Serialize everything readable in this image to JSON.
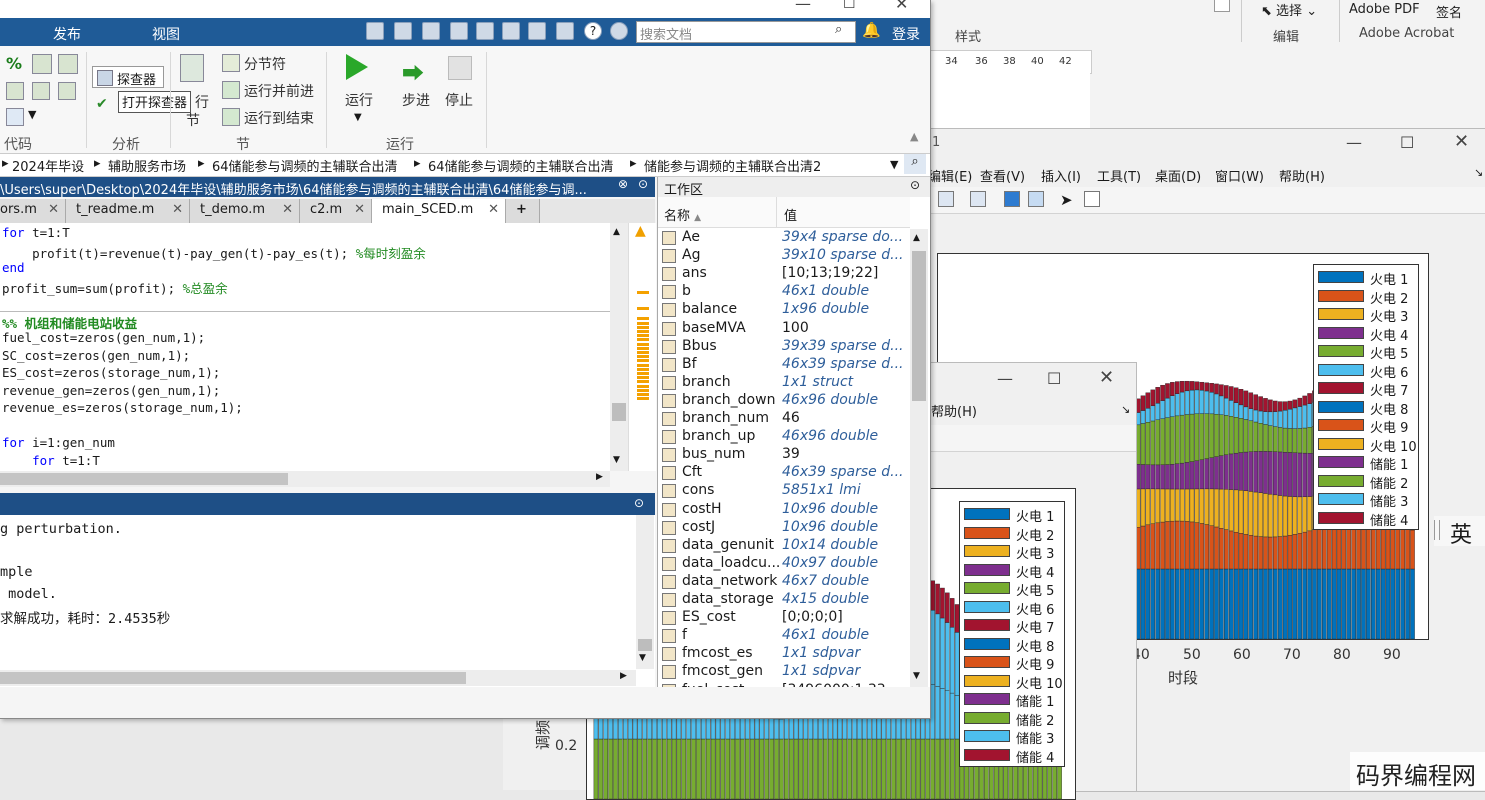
{
  "matlab": {
    "tabs": [
      "发布",
      "视图"
    ],
    "search_placeholder": "搜索文档",
    "login_label": "登录",
    "ribbon": {
      "browser_button": "探查器",
      "tooltip": "打开探查器",
      "run_section_partial": "行",
      "section_partial": "节",
      "section_break": "分节符",
      "run_and_advance": "运行并前进",
      "run_to_end": "运行到结束",
      "run": "运行",
      "step": "步进",
      "stop": "停止",
      "groups": [
        "代码",
        "分析",
        "节",
        "运行"
      ]
    },
    "address_bar": [
      "2024年毕设",
      "辅助服务市场",
      "64储能参与调频的主辅联合出清",
      "64储能参与调频的主辅联合出清",
      "储能参与调频的主辅联合出清2"
    ],
    "editor": {
      "title": "\\Users\\super\\Desktop\\2024年毕设\\辅助服务市场\\64储能参与调频的主辅联合出清\\64储能参与调...",
      "tabs": [
        "ors.m",
        "t_readme.m",
        "t_demo.m",
        "c2.m",
        "main_SCED.m"
      ],
      "add_tab": "+",
      "lines": [
        {
          "kw": "for",
          "text": " t=1:T"
        },
        {
          "indent": "    ",
          "text": "profit(t)=revenue(t)-pay_gen(t)-pay_es(t); ",
          "comment": "%每时刻盈余"
        },
        {
          "kw": "end",
          "text": ""
        },
        {
          "text": "profit_sum=sum(profit); ",
          "comment": "%总盈余"
        },
        {
          "text": ""
        },
        {
          "section": "%% 机组和储能电站收益"
        },
        {
          "text": "fuel_cost=zeros(gen_num,1);"
        },
        {
          "text": "SC_cost=zeros(gen_num,1);"
        },
        {
          "text": "ES_cost=zeros(storage_num,1);"
        },
        {
          "text": "revenue_gen=zeros(gen_num,1);"
        },
        {
          "text": "revenue_es=zeros(storage_num,1);"
        },
        {
          "text": ""
        },
        {
          "kw": "for",
          "text": " i=1:gen_num"
        },
        {
          "indent": "    ",
          "kw": "for",
          "text": " t=1:T"
        }
      ]
    },
    "command_window": {
      "lines": [
        "g perturbation.",
        "",
        "mple",
        " model.",
        "求解成功，耗时：2.4535秒"
      ]
    },
    "workspace": {
      "title": "工作区",
      "col_name": "名称",
      "col_value": "值",
      "rows": [
        {
          "name": "Ae",
          "value": "39x4 sparse do...",
          "italic": true
        },
        {
          "name": "Ag",
          "value": "39x10 sparse d...",
          "italic": true
        },
        {
          "name": "ans",
          "value": "[10;13;19;22]",
          "italic": false
        },
        {
          "name": "b",
          "value": "46x1 double",
          "italic": true
        },
        {
          "name": "balance",
          "value": "1x96 double",
          "italic": true
        },
        {
          "name": "baseMVA",
          "value": "100",
          "italic": false
        },
        {
          "name": "Bbus",
          "value": "39x39 sparse d...",
          "italic": true
        },
        {
          "name": "Bf",
          "value": "46x39 sparse d...",
          "italic": true
        },
        {
          "name": "branch",
          "value": "1x1 struct",
          "italic": true
        },
        {
          "name": "branch_down",
          "value": "46x96 double",
          "italic": true
        },
        {
          "name": "branch_num",
          "value": "46",
          "italic": false
        },
        {
          "name": "branch_up",
          "value": "46x96 double",
          "italic": true
        },
        {
          "name": "bus_num",
          "value": "39",
          "italic": false
        },
        {
          "name": "Cft",
          "value": "46x39 sparse d...",
          "italic": true
        },
        {
          "name": "cons",
          "value": "5851x1 lmi",
          "italic": true
        },
        {
          "name": "costH",
          "value": "10x96 double",
          "italic": true
        },
        {
          "name": "costJ",
          "value": "10x96 double",
          "italic": true
        },
        {
          "name": "data_genunit",
          "value": "10x14 double",
          "italic": true
        },
        {
          "name": "data_loadcu...",
          "value": "40x97 double",
          "italic": true
        },
        {
          "name": "data_network",
          "value": "46x7 double",
          "italic": true
        },
        {
          "name": "data_storage",
          "value": "4x15 double",
          "italic": true
        },
        {
          "name": "ES_cost",
          "value": "[0;0;0;0]",
          "italic": false
        },
        {
          "name": "f",
          "value": "46x1 double",
          "italic": true
        },
        {
          "name": "fmcost_es",
          "value": "1x1 sdpvar",
          "italic": true
        },
        {
          "name": "fmcost_gen",
          "value": "1x1 sdpvar",
          "italic": true
        },
        {
          "name": "fuel_cost",
          "value": "[3496000;1.33...",
          "italic": false
        }
      ]
    }
  },
  "word": {
    "find_label": "选择",
    "adobe_pdf": "Adobe PDF",
    "sign": "签名",
    "edit_group": "编辑",
    "acrobat_group": "Adobe Acrobat",
    "style_group": "样式",
    "ruler_ticks": [
      "34",
      "36",
      "38",
      "40",
      "42"
    ]
  },
  "figure1": {
    "menu": [
      "编辑(E)",
      "查看(V)",
      "插入(I)",
      "工具(T)",
      "桌面(D)",
      "窗口(W)",
      "帮助(H)"
    ],
    "title_partial": "1"
  },
  "figure2": {
    "menu_help": "帮助(H)"
  },
  "legend_entries": [
    {
      "label": "火电 1",
      "color": "#0072bd"
    },
    {
      "label": "火电 2",
      "color": "#d95319"
    },
    {
      "label": "火电 3",
      "color": "#edb120"
    },
    {
      "label": "火电 4",
      "color": "#7e2f8e"
    },
    {
      "label": "火电 5",
      "color": "#77ac30"
    },
    {
      "label": "火电 6",
      "color": "#4dbeee"
    },
    {
      "label": "火电 7",
      "color": "#a2142f"
    },
    {
      "label": "火电 8",
      "color": "#0072bd"
    },
    {
      "label": "火电 9",
      "color": "#d95319"
    },
    {
      "label": "火电 10",
      "color": "#edb120"
    },
    {
      "label": "储能 1",
      "color": "#7e2f8e"
    },
    {
      "label": "储能 2",
      "color": "#77ac30"
    },
    {
      "label": "储能 3",
      "color": "#4dbeee"
    },
    {
      "label": "储能 4",
      "color": "#a2142f"
    }
  ],
  "chart_data": [
    {
      "type": "bar",
      "stacked": true,
      "xlabel": "时段",
      "x_tick_labels": [
        "40",
        "50",
        "60",
        "70",
        "80",
        "90"
      ],
      "x_range": [
        1,
        96
      ],
      "legend": "top-right"
    },
    {
      "type": "bar",
      "stacked": true,
      "ylabel": "调频",
      "y_tick_labels": [
        "0.2"
      ],
      "legend": "top-right"
    }
  ],
  "ime_indicator": "英",
  "watermark": "码界编程网"
}
